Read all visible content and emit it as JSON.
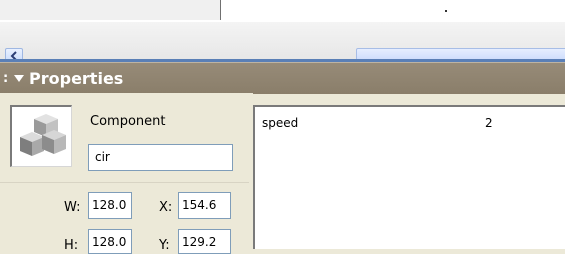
{
  "panel": {
    "title": "Properties"
  },
  "component": {
    "type_label": "Component",
    "instance_name": "cir"
  },
  "dimensions": {
    "w_label": "W:",
    "w_value": "128.0",
    "h_label": "H:",
    "h_value": "128.0",
    "x_label": "X:",
    "x_value": "154.6",
    "y_label": "Y:",
    "y_value": "129.2"
  },
  "parameters": [
    {
      "name": "speed",
      "value": "2"
    }
  ],
  "colors": {
    "header_bg": "#8f8370",
    "panel_bg": "#ece9d8",
    "accent_rule": "#5a7fb6"
  },
  "icons": {
    "scroll_left": "◀",
    "panel_collapse": "triangle-down-icon",
    "component": "cubes-icon",
    "grip": "grip-icon"
  }
}
